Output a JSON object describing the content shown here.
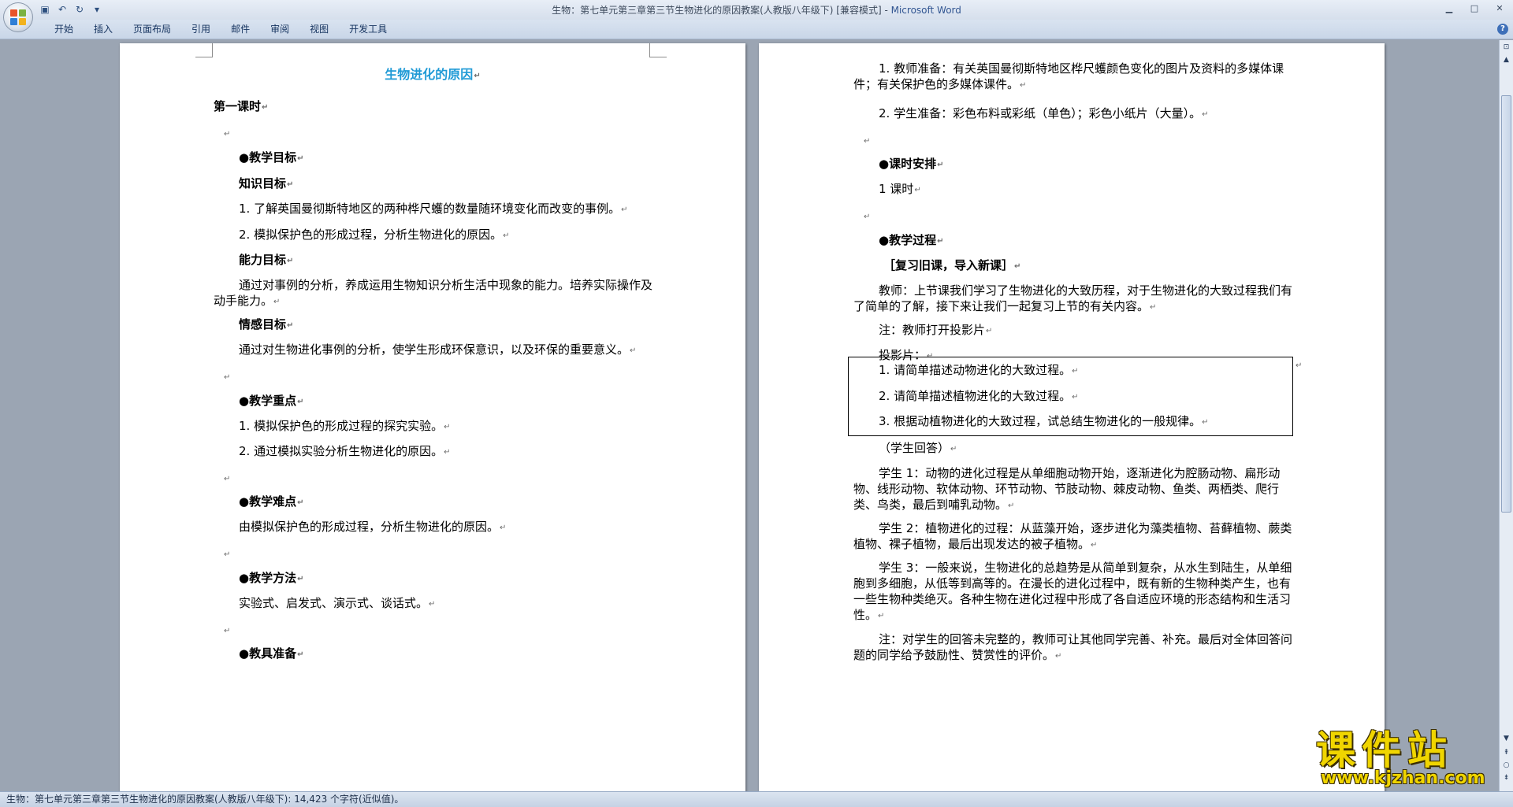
{
  "window": {
    "title": "生物：第七单元第三章第三节生物进化的原因教案(人教版八年级下) [兼容模式]",
    "separator": " - ",
    "app_name": "Microsoft Word"
  },
  "quick_access": [
    {
      "icon": "save-icon",
      "glyph": "▣"
    },
    {
      "icon": "undo-icon",
      "glyph": "↶"
    },
    {
      "icon": "redo-icon",
      "glyph": "↻"
    },
    {
      "icon": "customize-icon",
      "glyph": "▾"
    }
  ],
  "window_controls": {
    "minimize": "▁",
    "maximize": "□",
    "close": "✕"
  },
  "ribbon": {
    "tabs": [
      "开始",
      "插入",
      "页面布局",
      "引用",
      "邮件",
      "审阅",
      "视图",
      "开发工具"
    ],
    "help": "?"
  },
  "left_page": {
    "title": "生物进化的原因",
    "lesson": "第一课时",
    "goals_heading": "●教学目标",
    "knowledge_heading": "知识目标",
    "knowledge_1": "1. 了解英国曼彻斯特地区的两种桦尺蠖的数量随环境变化而改变的事例。",
    "knowledge_2": "2. 模拟保护色的形成过程，分析生物进化的原因。",
    "ability_heading": "能力目标",
    "ability_text": "通过对事例的分析，养成运用生物知识分析生活中现象的能力。培养实际操作及动手能力。",
    "emotion_heading": "情感目标",
    "emotion_text": "通过对生物进化事例的分析，使学生形成环保意识，以及环保的重要意义。",
    "key_heading": "●教学重点",
    "key_1": "1. 模拟保护色的形成过程的探究实验。",
    "key_2": "2. 通过模拟实验分析生物进化的原因。",
    "difficult_heading": "●教学难点",
    "difficult_text": "由模拟保护色的形成过程，分析生物进化的原因。",
    "method_heading": "●教学方法",
    "method_text": "实验式、启发式、演示式、谈话式。",
    "tools_heading": "●教具准备"
  },
  "right_page": {
    "teacher_prep": "1. 教师准备：有关英国曼彻斯特地区桦尺蠖颜色变化的图片及资料的多媒体课件；有关保护色的多媒体课件。",
    "student_prep": "2. 学生准备：彩色布料或彩纸（单色）；彩色小纸片（大量）。",
    "schedule_heading": "●课时安排",
    "schedule_text": "1 课时",
    "process_heading": "●教学过程",
    "review_heading": "［复习旧课，导入新课］",
    "teacher_talk": "教师：上节课我们学习了生物进化的大致历程，对于生物进化的大致过程我们有了简单的了解，接下来让我们一起复习上节的有关内容。",
    "note_projector": "注：教师打开投影片",
    "projector_label": "投影片：",
    "box_1": "1. 请简单描述动物进化的大致过程。",
    "box_2": "2. 请简单描述植物进化的大致过程。",
    "box_3": "3. 根据动植物进化的大致过程，试总结生物进化的一般规律。",
    "student_answer": "（学生回答）",
    "student_1": "学生 1：动物的进化过程是从单细胞动物开始，逐渐进化为腔肠动物、扁形动物、线形动物、软体动物、环节动物、节肢动物、棘皮动物、鱼类、两栖类、爬行类、鸟类，最后到哺乳动物。",
    "student_2": "学生 2：植物进化的过程：从蓝藻开始，逐步进化为藻类植物、苔藓植物、蕨类植物、裸子植物，最后出现发达的被子植物。",
    "student_3": "学生 3：一般来说，生物进化的总趋势是从简单到复杂，从水生到陆生，从单细胞到多细胞，从低等到高等的。在漫长的进化过程中，既有新的生物种类产生，也有一些生物种类绝灭。各种生物在进化过程中形成了各自适应环境的形态结构和生活习性。",
    "note_teacher": "注：对学生的回答未完整的，教师可让其他同学完善、补充。最后对全体回答问题的同学给予鼓励性、赞赏性的评价。"
  },
  "para_mark": "↵",
  "status": "生物：第七单元第三章第三节生物进化的原因教案(人教版八年级下): 14,423 个字符(近似值)。",
  "watermark": {
    "text": "课件站",
    "url": "www.kjzhan.com"
  },
  "colors": {
    "heading": "#1f9ad6",
    "title_app": "#315591",
    "watermark": "#f0d500"
  }
}
